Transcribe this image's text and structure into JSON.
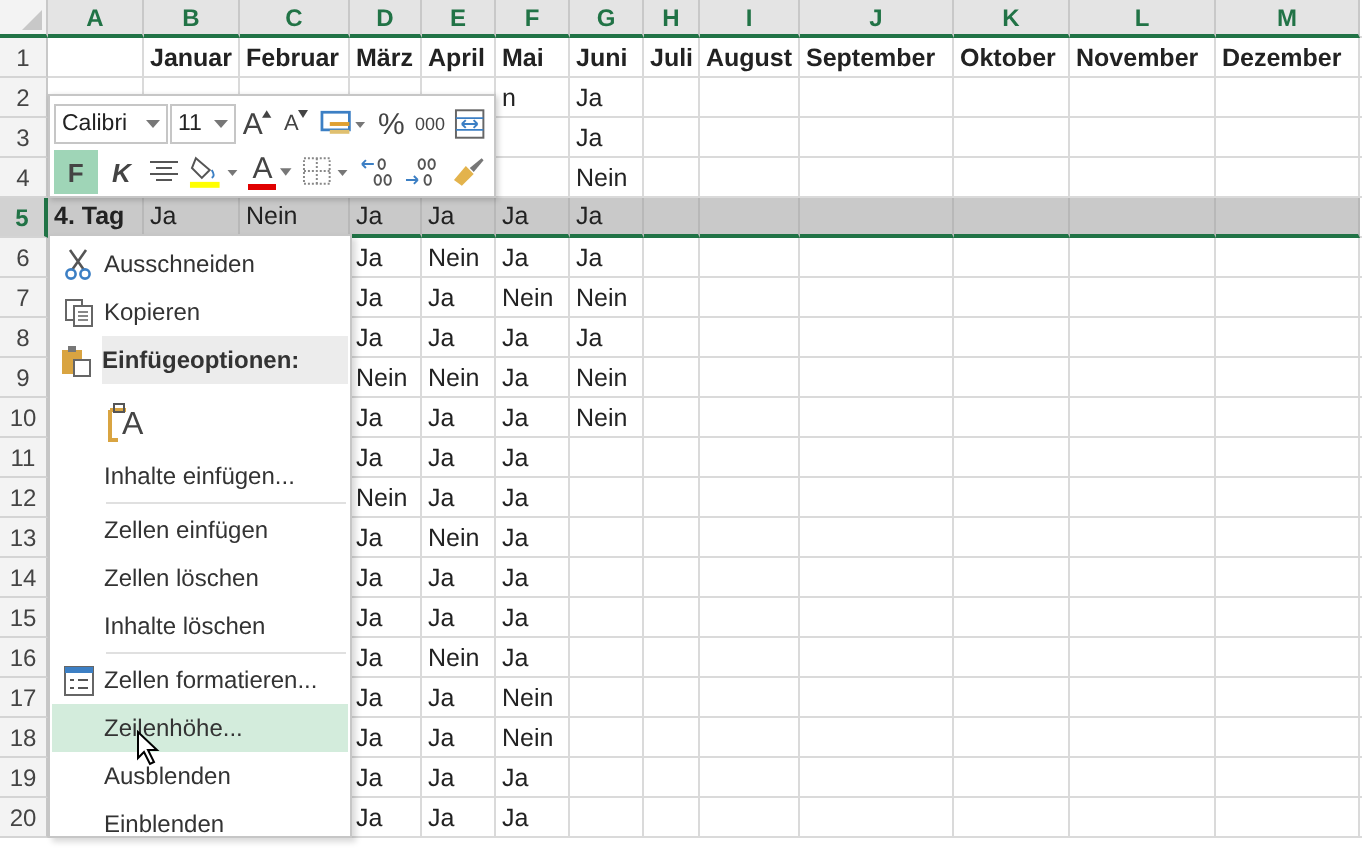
{
  "columns": [
    {
      "letter": "A"
    },
    {
      "letter": "B"
    },
    {
      "letter": "C"
    },
    {
      "letter": "D"
    },
    {
      "letter": "E"
    },
    {
      "letter": "F"
    },
    {
      "letter": "G"
    },
    {
      "letter": "H"
    },
    {
      "letter": "I"
    },
    {
      "letter": "J"
    },
    {
      "letter": "K"
    },
    {
      "letter": "L"
    },
    {
      "letter": "M"
    }
  ],
  "rows": [
    {
      "number": "1",
      "selected": false,
      "kind": "header",
      "cells": {
        "B": "Januar",
        "C": "Februar",
        "D": "März",
        "E": "April",
        "F": "Mai",
        "G": "Juni",
        "H": "Juli",
        "I": "August",
        "J": "September",
        "K": "Oktober",
        "L": "November",
        "M": "Dezember"
      }
    },
    {
      "number": "2",
      "selected": false,
      "kind": "data",
      "cells": {
        "F": "n",
        "G": "Ja"
      }
    },
    {
      "number": "3",
      "selected": false,
      "kind": "data",
      "cells": {
        "G": "Ja"
      }
    },
    {
      "number": "4",
      "selected": false,
      "kind": "data",
      "cells": {
        "G": "Nein"
      }
    },
    {
      "number": "5",
      "selected": true,
      "kind": "data",
      "cells": {
        "A": "4. Tag",
        "B": "Ja",
        "C": "Nein",
        "D": "Ja",
        "E": "Ja",
        "F": "Ja",
        "G": "Ja"
      }
    },
    {
      "number": "6",
      "selected": false,
      "kind": "data",
      "cells": {
        "D": "Ja",
        "E": "Nein",
        "F": "Ja",
        "G": "Ja"
      }
    },
    {
      "number": "7",
      "selected": false,
      "kind": "data",
      "cells": {
        "D": "Ja",
        "E": "Ja",
        "F": "Nein",
        "G": "Nein"
      }
    },
    {
      "number": "8",
      "selected": false,
      "kind": "data",
      "cells": {
        "D": "Ja",
        "E": "Ja",
        "F": "Ja",
        "G": "Ja"
      }
    },
    {
      "number": "9",
      "selected": false,
      "kind": "data",
      "cells": {
        "D": "Nein",
        "E": "Nein",
        "F": "Ja",
        "G": "Nein"
      }
    },
    {
      "number": "10",
      "selected": false,
      "kind": "data",
      "cells": {
        "D": "Ja",
        "E": "Ja",
        "F": "Ja",
        "G": "Nein"
      }
    },
    {
      "number": "11",
      "selected": false,
      "kind": "data",
      "cells": {
        "D": "Ja",
        "E": "Ja",
        "F": "Ja"
      }
    },
    {
      "number": "12",
      "selected": false,
      "kind": "data",
      "cells": {
        "D": "Nein",
        "E": "Ja",
        "F": "Ja"
      }
    },
    {
      "number": "13",
      "selected": false,
      "kind": "data",
      "cells": {
        "D": "Ja",
        "E": "Nein",
        "F": "Ja"
      }
    },
    {
      "number": "14",
      "selected": false,
      "kind": "data",
      "cells": {
        "D": "Ja",
        "E": "Ja",
        "F": "Ja"
      }
    },
    {
      "number": "15",
      "selected": false,
      "kind": "data",
      "cells": {
        "D": "Ja",
        "E": "Ja",
        "F": "Ja"
      }
    },
    {
      "number": "16",
      "selected": false,
      "kind": "data",
      "cells": {
        "D": "Ja",
        "E": "Nein",
        "F": "Ja"
      }
    },
    {
      "number": "17",
      "selected": false,
      "kind": "data",
      "cells": {
        "D": "Ja",
        "E": "Ja",
        "F": "Nein"
      }
    },
    {
      "number": "18",
      "selected": false,
      "kind": "data",
      "cells": {
        "D": "Ja",
        "E": "Ja",
        "F": "Nein"
      }
    },
    {
      "number": "19",
      "selected": false,
      "kind": "data",
      "cells": {
        "D": "Ja",
        "E": "Ja",
        "F": "Ja"
      }
    },
    {
      "number": "20",
      "selected": false,
      "kind": "data",
      "cells": {
        "D": "Ja",
        "E": "Ja",
        "F": "Ja"
      }
    }
  ],
  "mini_toolbar": {
    "font": "Calibri",
    "size": "11",
    "top_buttons": [
      {
        "kind": "grow-font",
        "label": "A"
      },
      {
        "kind": "shrink-font",
        "label": "A"
      },
      {
        "kind": "format-style"
      },
      {
        "kind": "percent",
        "label": "%"
      },
      {
        "kind": "thousands",
        "label": "000"
      },
      {
        "kind": "merge"
      }
    ],
    "bottom_buttons": [
      {
        "kind": "bold",
        "label": "F",
        "on": true
      },
      {
        "kind": "italic",
        "label": "K",
        "on": false
      },
      {
        "kind": "align-center"
      },
      {
        "kind": "fill-color"
      },
      {
        "kind": "font-color",
        "label": "A"
      },
      {
        "kind": "borders"
      },
      {
        "kind": "increase-decimal"
      },
      {
        "kind": "decrease-decimal"
      },
      {
        "kind": "format-painter"
      }
    ]
  },
  "context_menu": [
    {
      "kind": "cut",
      "label": "Ausschneiden",
      "selected": false
    },
    {
      "kind": "copy",
      "label": "Kopieren",
      "selected": false
    },
    {
      "kind": "paste-header",
      "label": "Einfügeoptionen:"
    },
    {
      "kind": "paste-choice",
      "label": "A",
      "selected": false
    },
    {
      "kind": "plain",
      "label": "Inhalte einfügen...",
      "selected": false
    },
    {
      "kind": "separator"
    },
    {
      "kind": "plain",
      "label": "Zellen einfügen",
      "selected": false
    },
    {
      "kind": "plain",
      "label": "Zellen löschen",
      "selected": false
    },
    {
      "kind": "plain",
      "label": "Inhalte löschen",
      "selected": false
    },
    {
      "kind": "separator"
    },
    {
      "kind": "format",
      "label": "Zellen formatieren...",
      "selected": false
    },
    {
      "kind": "plain",
      "label": "Zeilenhöhe...",
      "selected": true
    },
    {
      "kind": "plain",
      "label": "Ausblenden",
      "selected": false
    },
    {
      "kind": "plain",
      "label": "Einblenden",
      "selected": false
    }
  ]
}
